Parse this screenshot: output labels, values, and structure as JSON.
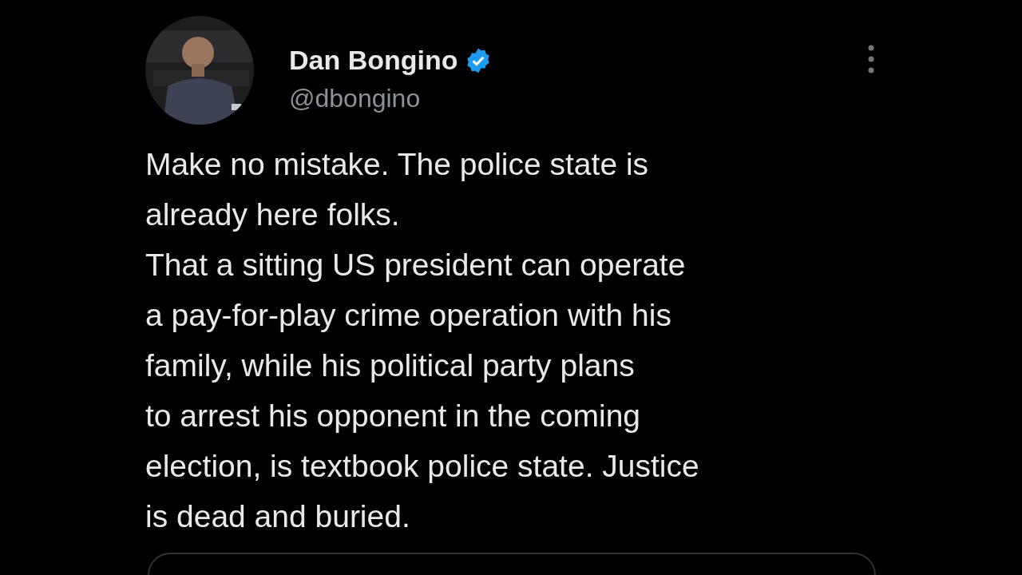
{
  "author": {
    "name": "Dan Bongino",
    "verified": true,
    "handle": "@dbongino"
  },
  "tweet": {
    "lines": [
      "Make no mistake. The police state is",
      "already here folks.",
      "That a sitting US president can operate",
      "a pay-for-play crime operation with his",
      "family, while his political party plans",
      "to arrest his opponent in the coming",
      "election, is textbook police state. Justice",
      "is dead and buried."
    ]
  }
}
